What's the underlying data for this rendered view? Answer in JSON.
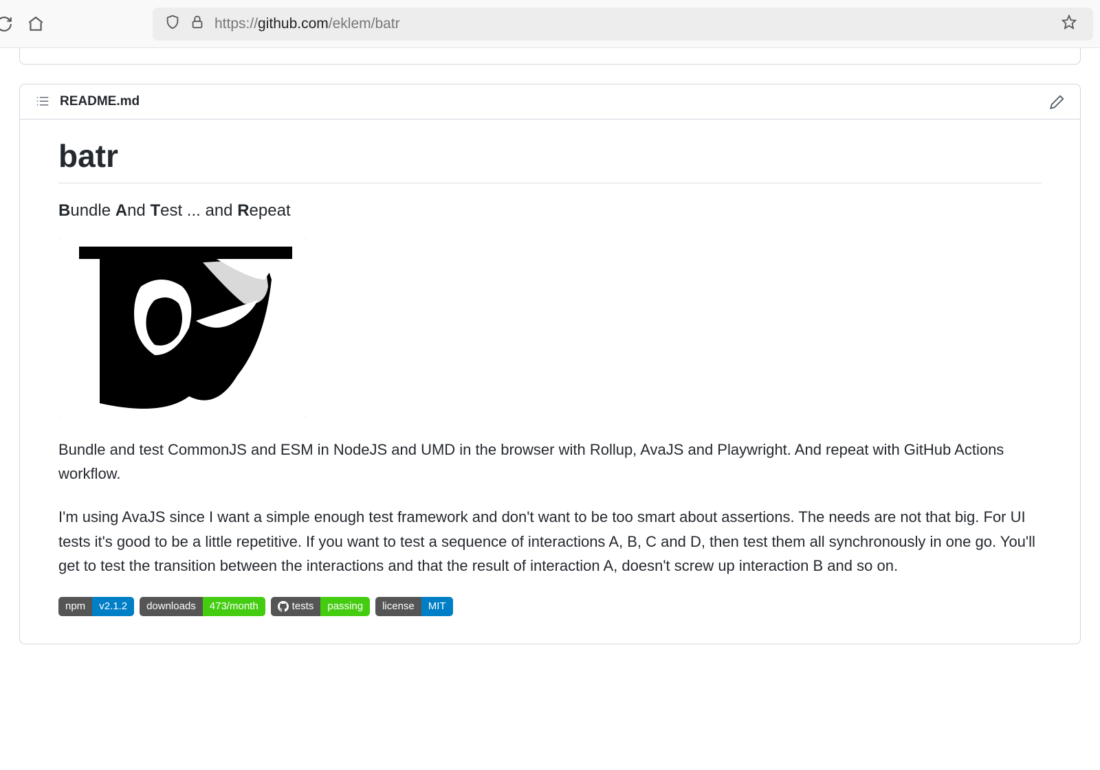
{
  "browser": {
    "url_prefix": "https://",
    "url_domain": "github.com",
    "url_path": "/eklem/batr"
  },
  "readme": {
    "filename": "README.md",
    "title": "batr",
    "subtitle": {
      "b1": "B",
      "t1": "undle ",
      "b2": "A",
      "t2": "nd ",
      "b3": "T",
      "t3": "est ... and ",
      "b4": "R",
      "t4": "epeat"
    },
    "para1": "Bundle and test CommonJS and ESM in NodeJS and UMD in the browser with Rollup, AvaJS and Playwright. And repeat with GitHub Actions workflow.",
    "para2": "I'm using AvaJS since I want a simple enough test framework and don't want to be too smart about assertions. The needs are not that big. For UI tests it's good to be a little repetitive. If you want to test a sequence of interactions A, B, C and D, then test them all synchronously in one go. You'll get to test the transition between the interactions and that the result of interaction A, doesn't screw up interaction B and so on."
  },
  "badges": [
    {
      "left": "npm",
      "right": "v2.1.2",
      "color": "#007ec6",
      "icon": ""
    },
    {
      "left": "downloads",
      "right": "473/month",
      "color": "#4c1",
      "icon": ""
    },
    {
      "left": "tests",
      "right": "passing",
      "color": "#4c1",
      "icon": "github"
    },
    {
      "left": "license",
      "right": "MIT",
      "color": "#007ec6",
      "icon": ""
    }
  ]
}
